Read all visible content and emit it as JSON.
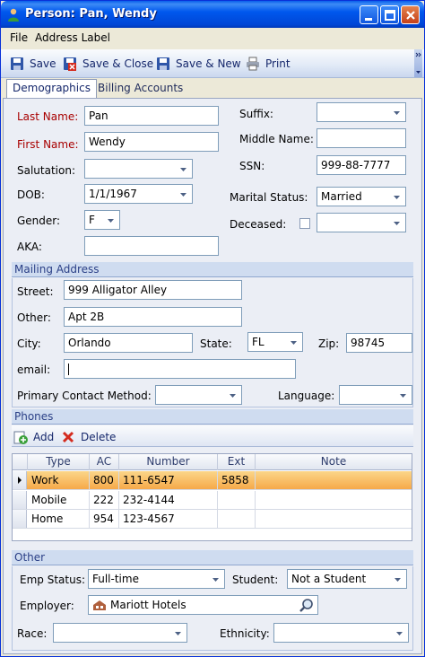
{
  "window": {
    "title": "Person: Pan, Wendy"
  },
  "menu": [
    "File",
    "Address Label"
  ],
  "toolbar": {
    "save": "Save",
    "save_close": "Save & Close",
    "save_new": "Save & New",
    "print": "Print"
  },
  "tabs": [
    "Demographics",
    "Billing Accounts"
  ],
  "demographics": {
    "last_name_label": "Last Name:",
    "last_name": "Pan",
    "first_name_label": "First Name:",
    "first_name": "Wendy",
    "salutation_label": "Salutation:",
    "salutation": "",
    "dob_label": "DOB:",
    "dob": "1/1/1967",
    "gender_label": "Gender:",
    "gender": "F",
    "aka_label": "AKA:",
    "aka": "",
    "suffix_label": "Suffix:",
    "suffix": "",
    "middle_name_label": "Middle Name:",
    "middle_name": "",
    "ssn_label": "SSN:",
    "ssn": "999-88-7777",
    "marital_label": "Marital Status:",
    "marital": "Married",
    "deceased_label": "Deceased:",
    "deceased": ""
  },
  "mailing": {
    "header": "Mailing Address",
    "street_label": "Street:",
    "street": "999 Alligator Alley",
    "other_label": "Other:",
    "other": "Apt 2B",
    "city_label": "City:",
    "city": "Orlando",
    "state_label": "State:",
    "state": "FL",
    "zip_label": "Zip:",
    "zip": "98745",
    "email_label": "email:",
    "email": "",
    "contact_label": "Primary Contact Method:",
    "contact": "",
    "language_label": "Language:",
    "language": ""
  },
  "phones": {
    "header": "Phones",
    "add": "Add",
    "delete": "Delete",
    "columns": [
      "Type",
      "AC",
      "Number",
      "Ext",
      "Note"
    ],
    "rows": [
      {
        "type": "Work",
        "ac": "800",
        "number": "111-6547",
        "ext": "5858",
        "note": ""
      },
      {
        "type": "Mobile",
        "ac": "222",
        "number": "232-4144",
        "ext": "",
        "note": ""
      },
      {
        "type": "Home",
        "ac": "954",
        "number": "123-4567",
        "ext": "",
        "note": ""
      }
    ]
  },
  "other": {
    "header": "Other",
    "emp_status_label": "Emp Status:",
    "emp_status": "Full-time",
    "student_label": "Student:",
    "student": "Not a Student",
    "employer_label": "Employer:",
    "employer": "Mariott Hotels",
    "race_label": "Race:",
    "race": "",
    "ethnicity_label": "Ethnicity:",
    "ethnicity": ""
  }
}
